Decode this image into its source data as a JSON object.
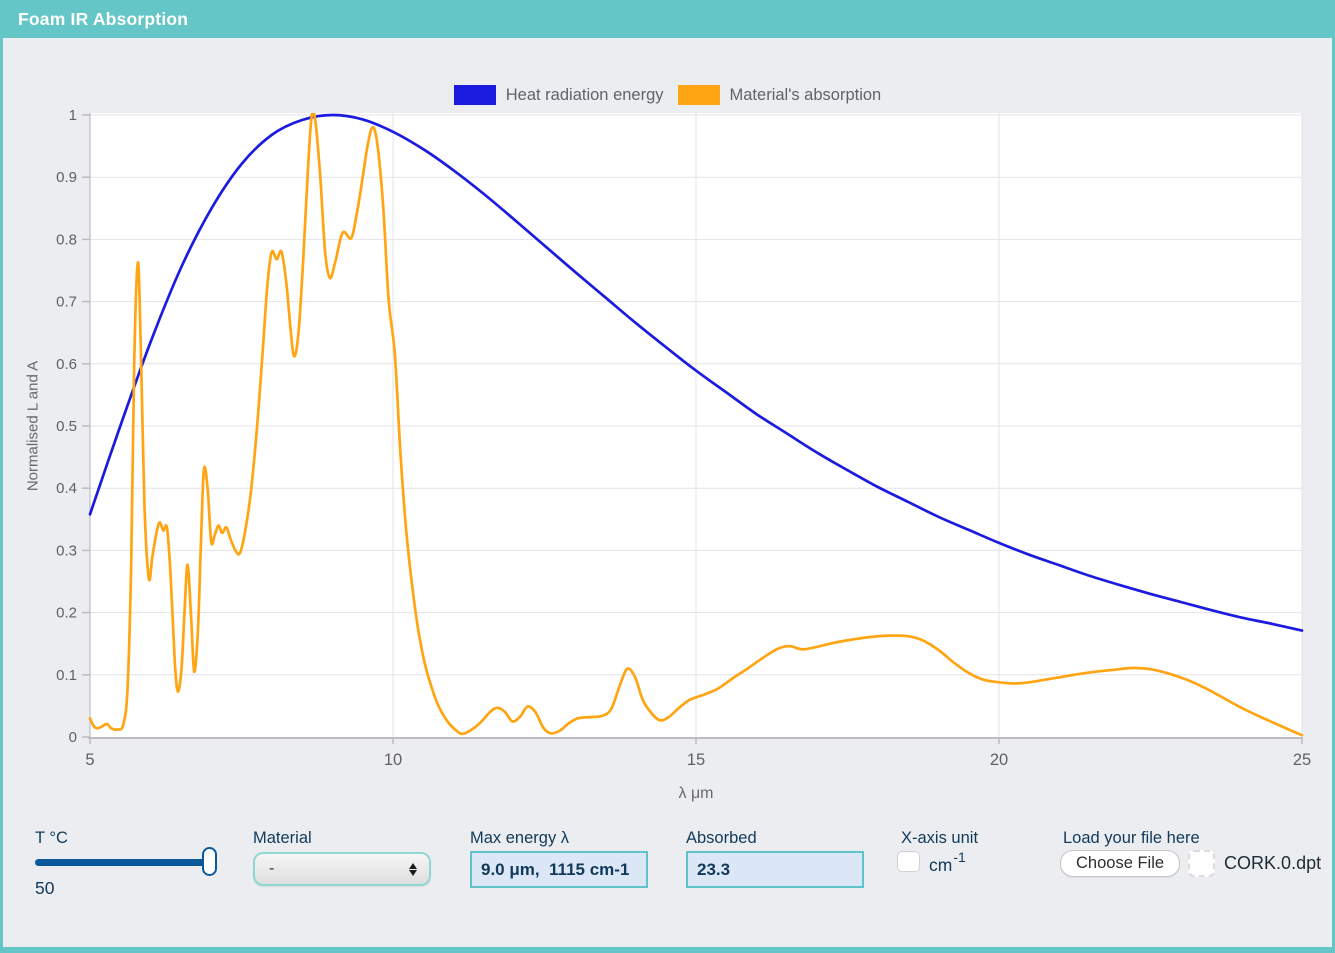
{
  "app": {
    "title": "Foam IR Absorption"
  },
  "theme": {
    "teal": "#64c6c6",
    "background": "#ecedf1",
    "navy_text": "#113a5a",
    "slider_blue": "#0a5a9b",
    "field_bg": "#dbe6f6",
    "field_border": "#5fc4c8",
    "plot_bg": "#ffffff",
    "grid_color": "#e3e3e8",
    "axis_color": "#bcbcc1",
    "tick_text": "#616161",
    "heat_blue": "#1b1be0",
    "absorption_orange": "#ffa513"
  },
  "legend": {
    "items": [
      {
        "label": "Heat radiation energy",
        "color": "#1b1be0"
      },
      {
        "label": "Material's absorption",
        "color": "#ffa513"
      }
    ]
  },
  "chart_data": {
    "type": "line",
    "title": "",
    "xlabel": "λ μm",
    "ylabel": "Normalised L and A",
    "xlim": [
      5,
      25
    ],
    "ylim": [
      0,
      1
    ],
    "x_ticks": [
      5,
      10,
      15,
      20,
      25
    ],
    "y_ticks": [
      0,
      0.1,
      0.2,
      0.3,
      0.4,
      0.5,
      0.6,
      0.7,
      0.8,
      0.9,
      1
    ],
    "grid": true,
    "legend_position": "top-center",
    "series": [
      {
        "name": "Heat radiation energy",
        "color": "#1b1be0",
        "points": [
          [
            5,
            0.358
          ],
          [
            5.5,
            0.5
          ],
          [
            6,
            0.635
          ],
          [
            6.5,
            0.754
          ],
          [
            7,
            0.849
          ],
          [
            7.5,
            0.921
          ],
          [
            8,
            0.968
          ],
          [
            8.5,
            0.992
          ],
          [
            9,
            1.0
          ],
          [
            9.5,
            0.993
          ],
          [
            10,
            0.973
          ],
          [
            10.5,
            0.945
          ],
          [
            11,
            0.911
          ],
          [
            11.5,
            0.873
          ],
          [
            12,
            0.832
          ],
          [
            12.5,
            0.79
          ],
          [
            13,
            0.748
          ],
          [
            13.5,
            0.707
          ],
          [
            14,
            0.666
          ],
          [
            14.5,
            0.627
          ],
          [
            15,
            0.589
          ],
          [
            15.5,
            0.554
          ],
          [
            16,
            0.519
          ],
          [
            16.5,
            0.488
          ],
          [
            17,
            0.457
          ],
          [
            17.5,
            0.429
          ],
          [
            18,
            0.402
          ],
          [
            18.5,
            0.378
          ],
          [
            19,
            0.354
          ],
          [
            19.5,
            0.333
          ],
          [
            20,
            0.312
          ],
          [
            20.5,
            0.293
          ],
          [
            21,
            0.276
          ],
          [
            21.5,
            0.259
          ],
          [
            22,
            0.244
          ],
          [
            22.5,
            0.23
          ],
          [
            23,
            0.217
          ],
          [
            23.5,
            0.204
          ],
          [
            24,
            0.192
          ],
          [
            24.5,
            0.182
          ],
          [
            25,
            0.171
          ]
        ]
      },
      {
        "name": "Material's absorption",
        "color": "#ffa513",
        "points": [
          [
            5,
            0.03
          ],
          [
            5.06,
            0.018
          ],
          [
            5.12,
            0.014
          ],
          [
            5.2,
            0.017
          ],
          [
            5.28,
            0.021
          ],
          [
            5.35,
            0.014
          ],
          [
            5.45,
            0.012
          ],
          [
            5.55,
            0.02
          ],
          [
            5.62,
            0.08
          ],
          [
            5.68,
            0.28
          ],
          [
            5.73,
            0.6
          ],
          [
            5.79,
            0.763
          ],
          [
            5.84,
            0.62
          ],
          [
            5.9,
            0.37
          ],
          [
            5.97,
            0.255
          ],
          [
            6.03,
            0.29
          ],
          [
            6.1,
            0.33
          ],
          [
            6.15,
            0.345
          ],
          [
            6.21,
            0.332
          ],
          [
            6.27,
            0.336
          ],
          [
            6.33,
            0.26
          ],
          [
            6.4,
            0.12
          ],
          [
            6.45,
            0.073
          ],
          [
            6.51,
            0.11
          ],
          [
            6.56,
            0.2
          ],
          [
            6.61,
            0.277
          ],
          [
            6.67,
            0.19
          ],
          [
            6.72,
            0.105
          ],
          [
            6.78,
            0.17
          ],
          [
            6.83,
            0.31
          ],
          [
            6.88,
            0.43
          ],
          [
            6.94,
            0.4
          ],
          [
            7,
            0.314
          ],
          [
            7.06,
            0.325
          ],
          [
            7.12,
            0.34
          ],
          [
            7.18,
            0.328
          ],
          [
            7.25,
            0.337
          ],
          [
            7.32,
            0.318
          ],
          [
            7.4,
            0.3
          ],
          [
            7.47,
            0.295
          ],
          [
            7.55,
            0.325
          ],
          [
            7.65,
            0.39
          ],
          [
            7.75,
            0.49
          ],
          [
            7.85,
            0.62
          ],
          [
            7.93,
            0.73
          ],
          [
            8,
            0.78
          ],
          [
            8.08,
            0.768
          ],
          [
            8.16,
            0.78
          ],
          [
            8.24,
            0.73
          ],
          [
            8.31,
            0.655
          ],
          [
            8.37,
            0.612
          ],
          [
            8.44,
            0.65
          ],
          [
            8.52,
            0.77
          ],
          [
            8.6,
            0.92
          ],
          [
            8.66,
            1.0
          ],
          [
            8.72,
            0.99
          ],
          [
            8.8,
            0.9
          ],
          [
            8.88,
            0.78
          ],
          [
            8.96,
            0.738
          ],
          [
            9.05,
            0.765
          ],
          [
            9.17,
            0.811
          ],
          [
            9.31,
            0.802
          ],
          [
            9.4,
            0.84
          ],
          [
            9.5,
            0.9
          ],
          [
            9.58,
            0.95
          ],
          [
            9.66,
            0.98
          ],
          [
            9.74,
            0.955
          ],
          [
            9.84,
            0.85
          ],
          [
            9.93,
            0.7
          ],
          [
            10.03,
            0.617
          ],
          [
            10.12,
            0.46
          ],
          [
            10.22,
            0.33
          ],
          [
            10.32,
            0.24
          ],
          [
            10.42,
            0.17
          ],
          [
            10.52,
            0.12
          ],
          [
            10.62,
            0.085
          ],
          [
            10.75,
            0.05
          ],
          [
            10.9,
            0.025
          ],
          [
            11.05,
            0.01
          ],
          [
            11.15,
            0.005
          ],
          [
            11.3,
            0.012
          ],
          [
            11.45,
            0.024
          ],
          [
            11.6,
            0.04
          ],
          [
            11.72,
            0.047
          ],
          [
            11.85,
            0.04
          ],
          [
            11.97,
            0.025
          ],
          [
            12.1,
            0.033
          ],
          [
            12.22,
            0.049
          ],
          [
            12.35,
            0.04
          ],
          [
            12.48,
            0.015
          ],
          [
            12.6,
            0.006
          ],
          [
            12.75,
            0.01
          ],
          [
            12.9,
            0.022
          ],
          [
            13.05,
            0.03
          ],
          [
            13.25,
            0.032
          ],
          [
            13.45,
            0.034
          ],
          [
            13.6,
            0.045
          ],
          [
            13.75,
            0.085
          ],
          [
            13.87,
            0.11
          ],
          [
            14,
            0.095
          ],
          [
            14.12,
            0.06
          ],
          [
            14.25,
            0.04
          ],
          [
            14.4,
            0.027
          ],
          [
            14.55,
            0.032
          ],
          [
            14.72,
            0.047
          ],
          [
            14.9,
            0.06
          ],
          [
            15.1,
            0.067
          ],
          [
            15.35,
            0.077
          ],
          [
            15.6,
            0.094
          ],
          [
            15.85,
            0.11
          ],
          [
            16.1,
            0.127
          ],
          [
            16.35,
            0.142
          ],
          [
            16.55,
            0.146
          ],
          [
            16.75,
            0.141
          ],
          [
            17,
            0.145
          ],
          [
            17.3,
            0.152
          ],
          [
            17.6,
            0.157
          ],
          [
            17.9,
            0.161
          ],
          [
            18.2,
            0.163
          ],
          [
            18.5,
            0.162
          ],
          [
            18.75,
            0.155
          ],
          [
            19,
            0.14
          ],
          [
            19.25,
            0.12
          ],
          [
            19.5,
            0.103
          ],
          [
            19.75,
            0.092
          ],
          [
            20,
            0.088
          ],
          [
            20.25,
            0.086
          ],
          [
            20.5,
            0.088
          ],
          [
            20.75,
            0.092
          ],
          [
            21,
            0.096
          ],
          [
            21.3,
            0.101
          ],
          [
            21.6,
            0.105
          ],
          [
            21.9,
            0.108
          ],
          [
            22.2,
            0.111
          ],
          [
            22.5,
            0.109
          ],
          [
            22.8,
            0.102
          ],
          [
            23.1,
            0.092
          ],
          [
            23.4,
            0.079
          ],
          [
            23.7,
            0.063
          ],
          [
            24,
            0.047
          ],
          [
            24.3,
            0.033
          ],
          [
            24.6,
            0.02
          ],
          [
            24.85,
            0.009
          ],
          [
            25,
            0.003
          ]
        ]
      }
    ]
  },
  "controls": {
    "temperature": {
      "label": "T °C",
      "value": "50"
    },
    "material": {
      "label": "Material",
      "selected": "-"
    },
    "max_energy": {
      "label": "Max energy λ",
      "value": "9.0 μm,  1115 cm-1"
    },
    "absorbed": {
      "label": "Absorbed",
      "value": "23.3"
    },
    "x_axis_unit": {
      "label": "X-axis unit",
      "unit": "cm",
      "unit_sup": "-1",
      "checked": false
    },
    "file": {
      "label": "Load your file here",
      "button_label": "Choose File",
      "filename": "CORK.0.dpt"
    }
  }
}
